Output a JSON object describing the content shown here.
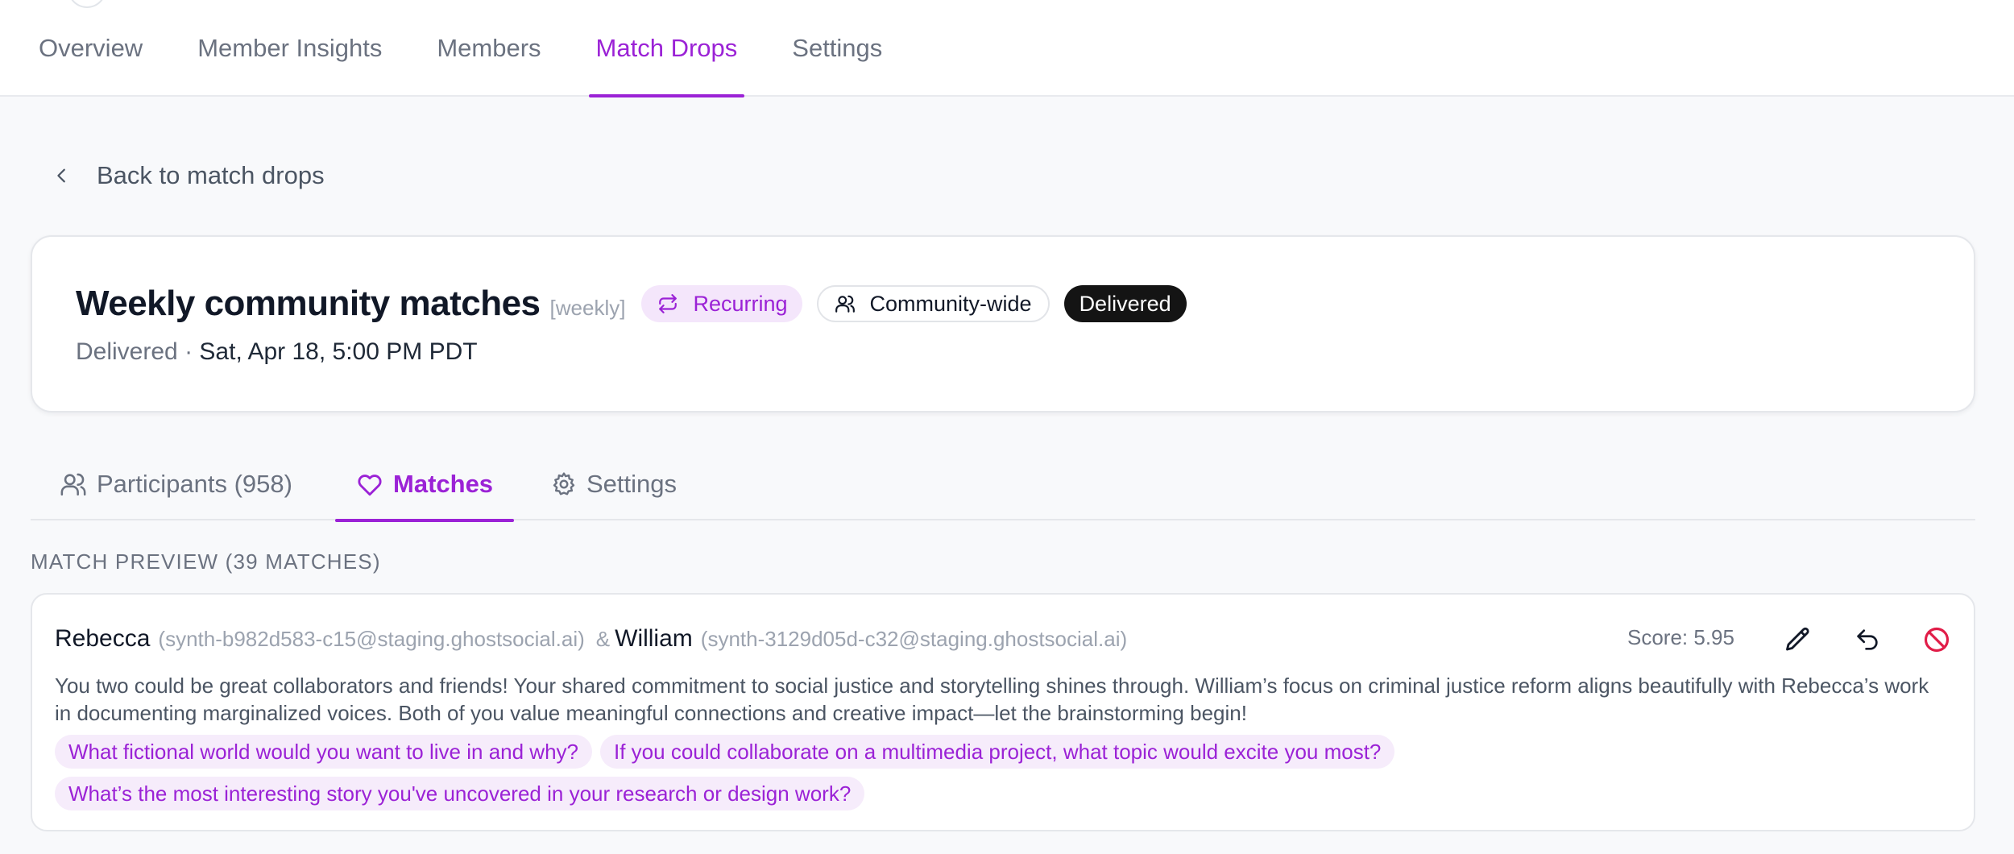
{
  "top_nav": {
    "tabs": [
      {
        "label": "Overview"
      },
      {
        "label": "Member Insights"
      },
      {
        "label": "Members"
      },
      {
        "label": "Match Drops",
        "active": true
      },
      {
        "label": "Settings"
      }
    ]
  },
  "back_link": "Back to match drops",
  "drop": {
    "title": "Weekly community matches",
    "frequency": "[weekly]",
    "badges": {
      "recurring": "Recurring",
      "scope": "Community-wide",
      "status": "Delivered"
    },
    "status_label": "Delivered",
    "separator": "·",
    "delivered_at": "Sat, Apr 18, 5:00 PM PDT"
  },
  "sub_tabs": {
    "participants": "Participants (958)",
    "matches": "Matches",
    "settings": "Settings"
  },
  "section_label": "MATCH PREVIEW (39 MATCHES)",
  "match": {
    "person_a": {
      "name": "Rebecca",
      "email": "(synth-b982d583-c15@staging.ghostsocial.ai)"
    },
    "ampersand": "&",
    "person_b": {
      "name": "William",
      "email": "(synth-3129d05d-c32@staging.ghostsocial.ai)"
    },
    "score": "Score: 5.95",
    "description": "You two could be great collaborators and friends! Your shared commitment to social justice and storytelling shines through. William’s focus on criminal justice reform aligns beautifully with Rebecca’s work in documenting marginalized voices. Both of you value meaningful connections and creative impact—let the brainstorming begin!",
    "prompts": [
      "What fictional world would you want to live in and why?",
      "If you could collaborate on a multimedia project, what topic would excite you most?",
      "What’s the most interesting story you've uncovered in your research or design work?"
    ]
  },
  "colors": {
    "accent": "#9b22d6",
    "danger": "#e11d48",
    "delivered_badge": "#141414"
  }
}
